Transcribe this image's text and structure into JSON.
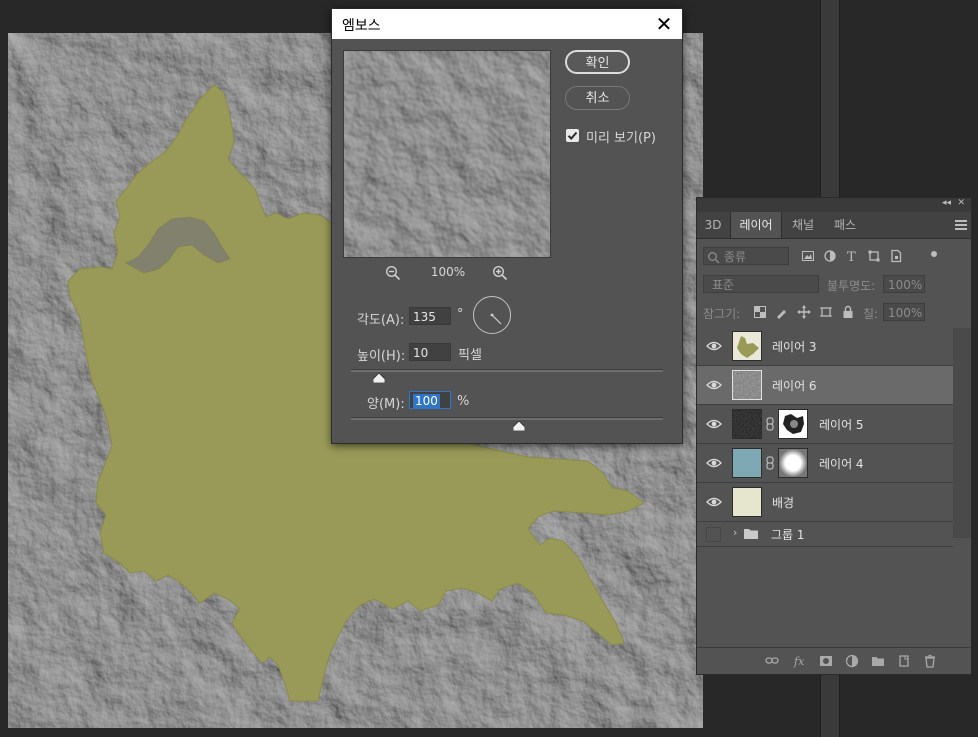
{
  "canvas": {
    "background": "#282828",
    "map_fill": "#9a9a58"
  },
  "dialog": {
    "title": "엠보스",
    "ok_label": "확인",
    "cancel_label": "취소",
    "preview_label": "미리 보기(P)",
    "preview_checked": true,
    "zoom": "100%",
    "angle_label": "각도(A):",
    "angle_value": "135",
    "angle_unit": "°",
    "height_label": "높이(H):",
    "height_value": "10",
    "height_unit": "픽셀",
    "amount_label": "양(M):",
    "amount_value": "100",
    "amount_unit": "%",
    "height_slider_fraction": 0.09,
    "amount_slider_fraction": 0.54
  },
  "layers_panel": {
    "tabs": [
      "3D",
      "레이어",
      "채널",
      "패스"
    ],
    "active_tab": "레이어",
    "filter_placeholder": "종류",
    "blend_mode": "표준",
    "opacity_label": "불투명도:",
    "opacity_value": "100%",
    "lock_label": "잠그기:",
    "fill_label": "칠:",
    "fill_value": "100%",
    "layers": [
      {
        "name": "레이어 3",
        "visible": true,
        "active": false,
        "thumb": "map"
      },
      {
        "name": "레이어 6",
        "visible": true,
        "active": true,
        "thumb": "noise"
      },
      {
        "name": "레이어 5",
        "visible": true,
        "active": false,
        "thumb": "dark-noise",
        "mask": true
      },
      {
        "name": "레이어 4",
        "visible": true,
        "active": false,
        "thumb": "teal",
        "mask": true
      },
      {
        "name": "배경",
        "visible": true,
        "active": false,
        "thumb": "cream"
      }
    ],
    "group": {
      "name": "그룹 1"
    },
    "colors": {
      "teal": "#7ea8b3",
      "cream": "#e6e5cd",
      "map": "#9a9a58"
    }
  }
}
